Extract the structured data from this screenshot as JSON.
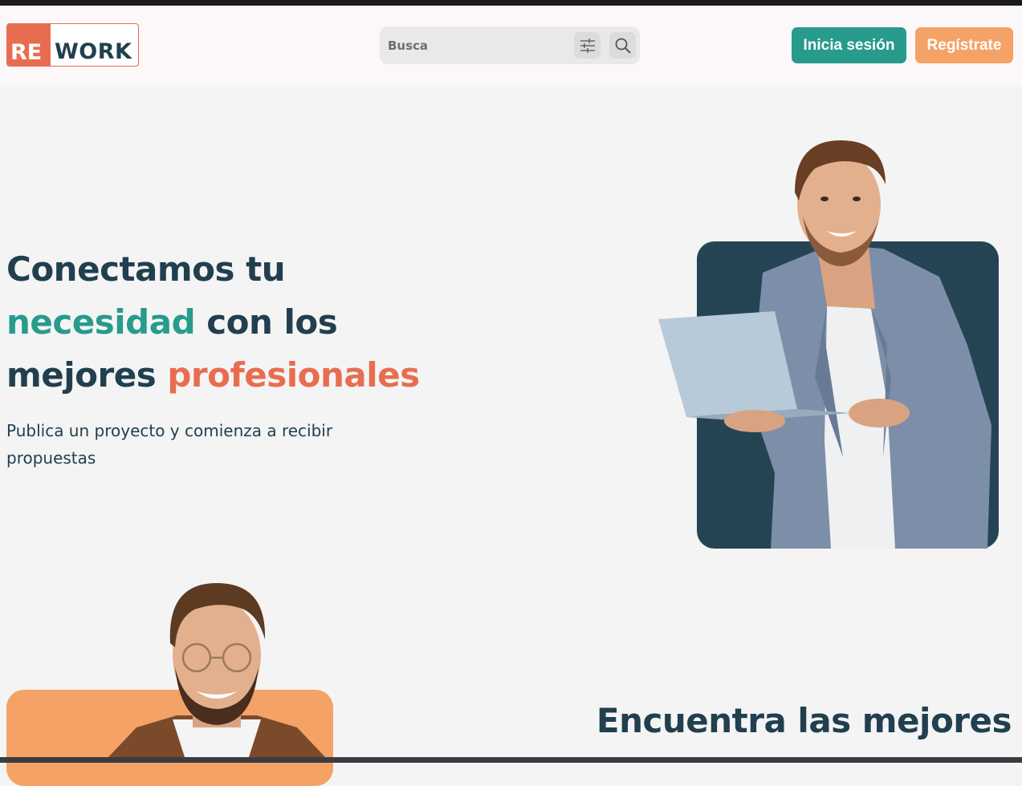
{
  "header": {
    "logo": {
      "part1": "RE",
      "part2": "WORK"
    },
    "search": {
      "placeholder": "Busca",
      "filter_icon": "sliders-icon",
      "search_icon": "search-icon"
    },
    "login_label": "Inicia sesión",
    "register_label": "Regístrate"
  },
  "hero": {
    "title_part1": "Conectamos tu",
    "title_highlight1": "necesidad",
    "title_part2": " con los",
    "title_part3": "mejores ",
    "title_highlight2": "profesionales",
    "subtitle": "Publica un proyecto y comienza a recibir propuestas",
    "image": "man-with-laptop-photo"
  },
  "section2": {
    "title": "Encuentra las mejores",
    "image": "smiling-man-with-glasses-photo"
  },
  "colors": {
    "dark_blue": "#213f4f",
    "teal": "#279b8c",
    "coral": "#e86d50",
    "orange": "#f4a266",
    "card_dark": "#244454"
  }
}
